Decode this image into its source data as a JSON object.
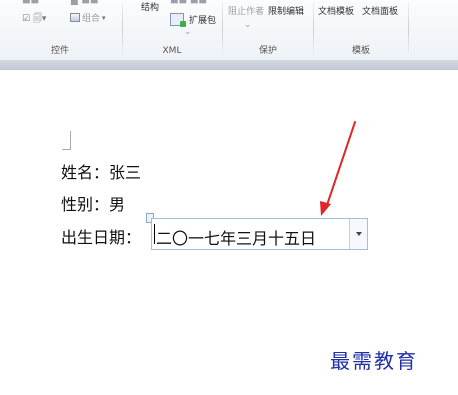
{
  "ribbon": {
    "controls_group": {
      "label": "控件",
      "row_top_a": "▬▬",
      "row_top_b": "■ ▬▬",
      "row2_item1": "☑ 🗐▾",
      "row2_item2": "组合",
      "row2_item2_caret": "▾"
    },
    "xml_group": {
      "label": "XML",
      "structure": "结构",
      "top_dim": "▬▬ ▬▬",
      "expansion_pack": "扩展包",
      "sub_caret": "⌄"
    },
    "protect_group": {
      "label": "保护",
      "block_authors": "阻止作者",
      "restrict_editing": "限制编辑",
      "sub_caret": "⌄"
    },
    "templates_group": {
      "label": "模板",
      "document_template": "文档模板",
      "document_panel": "文档面板"
    }
  },
  "document": {
    "line1": "姓名：张三",
    "line2": "性别：男",
    "line3_label": "出生日期：",
    "date_value": "二〇一七年三月十五日"
  },
  "watermark": "最需教育",
  "colors": {
    "arrow": "#e0262a",
    "watermark": "#1f2fa8",
    "datepicker_border": "#a9bdd7"
  }
}
